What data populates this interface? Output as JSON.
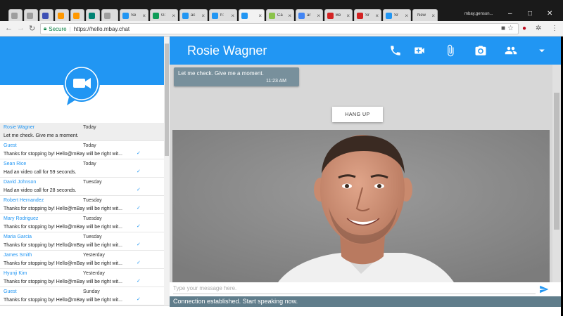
{
  "browser": {
    "tabs": [
      {
        "title": "",
        "icon": "page-icon",
        "color": "#9e9e9e"
      },
      {
        "title": "",
        "icon": "page-icon",
        "color": "#9e9e9e"
      },
      {
        "title": "",
        "icon": "app-icon",
        "color": "#3f51b5"
      },
      {
        "title": "",
        "icon": "bookmark-icon",
        "color": "#ff9800"
      },
      {
        "title": "",
        "icon": "bookmark-icon",
        "color": "#ff9800"
      },
      {
        "title": "",
        "icon": "bing-icon",
        "color": "#008373"
      },
      {
        "title": "",
        "icon": "page-icon",
        "color": "#9e9e9e"
      },
      {
        "title": "Se",
        "icon": "mbay-icon",
        "color": "#2196f3"
      },
      {
        "title": "G:",
        "icon": "hangouts-icon",
        "color": "#0f9d58"
      },
      {
        "title": "ac",
        "icon": "mbay-icon",
        "color": "#2196f3"
      },
      {
        "title": "h:",
        "icon": "mbay-icon",
        "color": "#2196f3"
      },
      {
        "title": "",
        "icon": "mbay-icon",
        "color": "#2196f3"
      },
      {
        "title": "Ca",
        "icon": "arrow-icon",
        "color": "#8bc34a"
      },
      {
        "title": "ar",
        "icon": "google-icon",
        "color": "#4285f4"
      },
      {
        "title": "Be",
        "icon": "yelp-icon",
        "color": "#d32323"
      },
      {
        "title": "Sr",
        "icon": "yelp-icon",
        "color": "#d32323"
      },
      {
        "title": "Sr",
        "icon": "share-icon",
        "color": "#2196f3"
      },
      {
        "title": "New",
        "icon": "",
        "color": ""
      }
    ],
    "profile": "mbay.gensun...",
    "secure_label": "Secure",
    "url": "https://hello.mbay.chat"
  },
  "chat_app": {
    "contact_name": "Rosie Wagner",
    "contacts": [
      {
        "name": "Rosie Wagner",
        "time": "Today",
        "message": "Let me check. Give me a moment.",
        "check": ""
      },
      {
        "name": "Guest",
        "time": "Today",
        "message": "Thanks for stopping by! Hello@mBay will be right wit...",
        "check": "✓"
      },
      {
        "name": "Sean Rice",
        "time": "Today",
        "message": "Had an video call for 59 seconds.",
        "check": "✓"
      },
      {
        "name": "David Johnson",
        "time": "Tuesday",
        "message": "Had an video call for 28 seconds.",
        "check": "✓"
      },
      {
        "name": "Robert Hernandez",
        "time": "Tuesday",
        "message": "Thanks for stopping by! Hello@mBay will be right wit...",
        "check": "✓"
      },
      {
        "name": "Mary Rodriguez",
        "time": "Tuesday",
        "message": "Thanks for stopping by! Hello@mBay will be right wit...",
        "check": "✓"
      },
      {
        "name": "Maria Garcia",
        "time": "Tuesday",
        "message": "Thanks for stopping by! Hello@mBay will be right wit...",
        "check": "✓"
      },
      {
        "name": "James Smith",
        "time": "Yesterday",
        "message": "Thanks for stopping by! Hello@mBay will be right wit...",
        "check": "✓"
      },
      {
        "name": "Hyunji Kim",
        "time": "Yesterday",
        "message": "Thanks for stopping by! Hello@mBay will be right wit...",
        "check": "✓"
      },
      {
        "name": "Guest",
        "time": "Sunday",
        "message": "Thanks for stopping by! Hello@mBay will be right wit...",
        "check": "✓"
      }
    ],
    "last_message": {
      "text": "Let me check. Give me a moment.",
      "time": "11:23 AM"
    },
    "hangup_label": "HANG UP",
    "message_placeholder": "Type your message here.",
    "status": "Connection established. Start speaking now.",
    "colors": {
      "primary": "#2196f3",
      "status_bar": "#607d8b",
      "bubble": "#78909c"
    }
  }
}
